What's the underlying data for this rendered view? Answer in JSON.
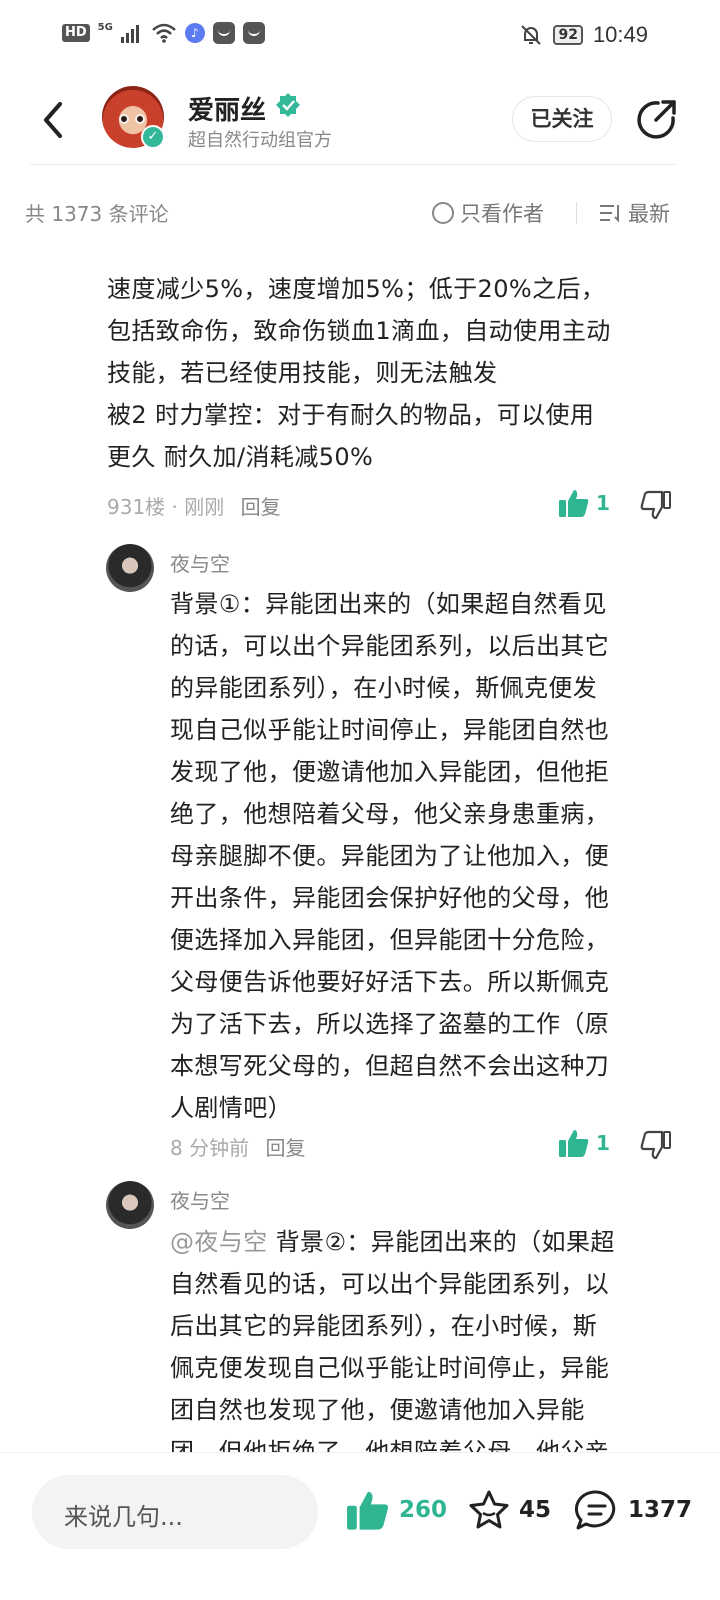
{
  "status_bar": {
    "hd": "HD",
    "network": "5G",
    "battery": "92",
    "time": "10:49"
  },
  "header": {
    "user_name": "爱丽丝",
    "user_subtitle": "超自然行动组官方",
    "follow_label": "已关注"
  },
  "comment_bar": {
    "count_text": "共 1373 条评论",
    "author_only": "只看作者",
    "sort": "最新"
  },
  "comments": [
    {
      "lines": [
        "速度减少5%，速度增加5%；低于20%之后，",
        "包括致命伤，致命伤锁血1滴血，自动使用主动",
        "技能，若已经使用技能，则无法触发",
        "被2 时力掌控：对于有耐久的物品，可以使用",
        "更久 耐久加/消耗减50%"
      ],
      "meta": "931楼 · 刚刚",
      "reply_label": "回复",
      "likes": "1"
    }
  ],
  "replies": [
    {
      "user": "夜与空",
      "lines": [
        "背景①：异能团出来的（如果超自然看见",
        "的话，可以出个异能团系列，以后出其它",
        "的异能团系列），在小时候，斯佩克便发",
        "现自己似乎能让时间停止，异能团自然也",
        "发现了他，便邀请他加入异能团，但他拒",
        "绝了，他想陪着父母，他父亲身患重病，",
        "母亲腿脚不便。异能团为了让他加入，便",
        "开出条件，异能团会保护好他的父母，他",
        "便选择加入异能团，但异能团十分危险，",
        "父母便告诉他要好好活下去。所以斯佩克",
        "为了活下去，所以选择了盗墓的工作（原",
        "本想写死父母的，但超自然不会出这种刀",
        "人剧情吧）"
      ],
      "time": "8 分钟前",
      "reply_label": "回复",
      "likes": "1"
    },
    {
      "user": "夜与空",
      "mention": "@夜与空",
      "lines": [
        "背景②：异能团出来的（如果超",
        "自然看见的话，可以出个异能团系列，以",
        "后出其它的异能团系列），在小时候，斯",
        "佩克便发现自己似乎能让时间停止，异能",
        "团自然也发现了他，便邀请他加入异能",
        "团，但他拒绝了，他想陪着父母，他父亲"
      ]
    }
  ],
  "bottom_bar": {
    "input_placeholder": "来说几句...",
    "likes": "260",
    "favorites": "45",
    "comments": "1377"
  },
  "colors": {
    "accent": "#2fb592",
    "text": "#222222",
    "muted": "#888888"
  }
}
